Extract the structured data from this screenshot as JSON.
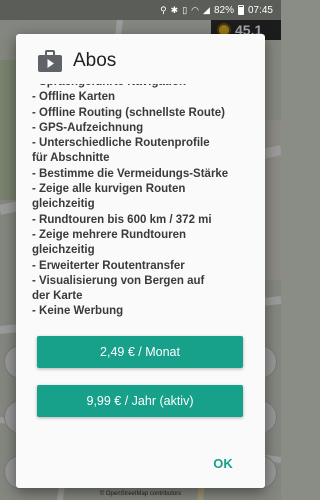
{
  "status_bar": {
    "battery": "82%",
    "time": "07:45",
    "icons": [
      "location-icon",
      "bluetooth-icon",
      "vibrate-icon",
      "wifi-icon",
      "signal-icon",
      "battery-icon"
    ]
  },
  "map": {
    "distance_fragment": "45.1",
    "credit": "© OpenStreetMap contributors"
  },
  "dialog": {
    "title": "Abos",
    "icon": "shopping-bag-icon",
    "features": [
      "- Sprachgeführte Navigation",
      "- Offline Karten",
      "- Offline Routing (schnellste Route)",
      "- GPS-Aufzeichnung",
      "- Unterschiedliche Routenprofile",
      "für Abschnitte",
      "- Bestimme die Vermeidungs-Stärke",
      "- Zeige alle kurvigen Routen",
      "gleichzeitig",
      "- Rundtouren bis 600 km / 372 mi",
      "- Zeige mehrere Rundtouren",
      "gleichzeitig",
      "- Erweiterter Routentransfer",
      "- Visualisierung von Bergen auf",
      "der Karte",
      "- Keine Werbung"
    ],
    "monthly_button": "2,49 € / Monat",
    "yearly_button": "9,99 € / Jahr (aktiv)",
    "ok_button": "OK"
  },
  "colors": {
    "accent": "#17a08a",
    "dialog_bg": "#fafafa",
    "title_text": "#212121"
  }
}
